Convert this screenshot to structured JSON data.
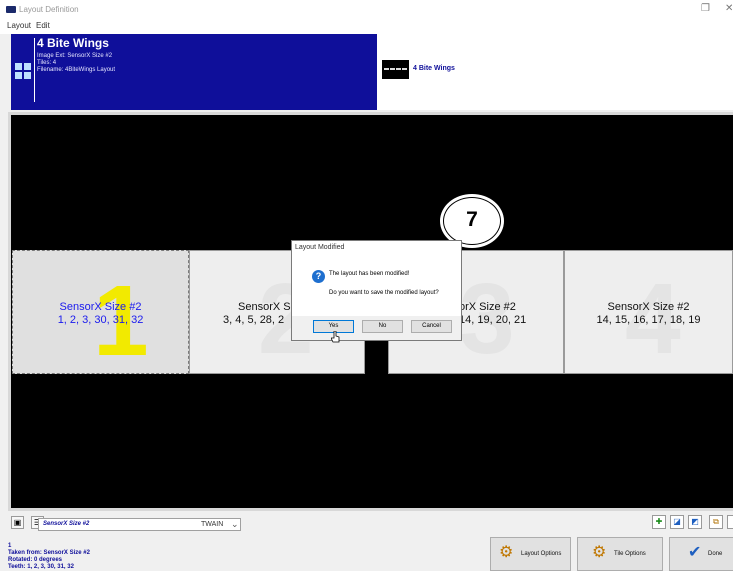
{
  "window": {
    "title": "Layout Definition"
  },
  "menu": [
    "Layout",
    "Edit"
  ],
  "header": {
    "title": "4 Bite Wings",
    "image_ext": "Image Ext: SensorX Size #2",
    "tiles": "Tiles: 4",
    "filename": "Filename: 4BiteWings Layout",
    "preview_label": "4 Bite Wings"
  },
  "tiles": [
    {
      "number": "1",
      "sensor": "SensorX Size #2",
      "teeth": "1, 2, 3, 30, 31, 32"
    },
    {
      "number": "2",
      "sensor": "SensorX Siz",
      "teeth": "3, 4, 5, 28, 2"
    },
    {
      "number": "3",
      "sensor": "orX Size #2",
      "teeth": "14, 19, 20, 21"
    },
    {
      "number": "4",
      "sensor": "SensorX Size #2",
      "teeth": "14, 15, 16, 17, 18, 19"
    }
  ],
  "callout": {
    "step": "7"
  },
  "dialog": {
    "title": "Layout Modified",
    "message1": "The layout has been modified!",
    "message2": "Do you want to save the modified layout?",
    "yes": "Yes",
    "no": "No",
    "cancel": "Cancel"
  },
  "bottom": {
    "sensor_select": "SensorX Size #2",
    "driver": "TWAIN",
    "info": {
      "tile_no": "1",
      "taken_from": "Taken from: SensorX Size #2",
      "rotated": "Rotated: 0 degrees",
      "teeth": "Teeth: 1, 2, 3, 30, 31, 32"
    },
    "layout_options": "Layout Options",
    "tile_options": "Tile Options",
    "done": "Done"
  },
  "colors": {
    "header_bg": "#0f0f9a",
    "tile1_number": "#f2ea00",
    "tile1_text": "#1a1aee"
  },
  "icons": [
    "app-icon",
    "tiles-icon",
    "question-icon",
    "cursor-icon",
    "settings-icon",
    "checkmark-icon"
  ]
}
